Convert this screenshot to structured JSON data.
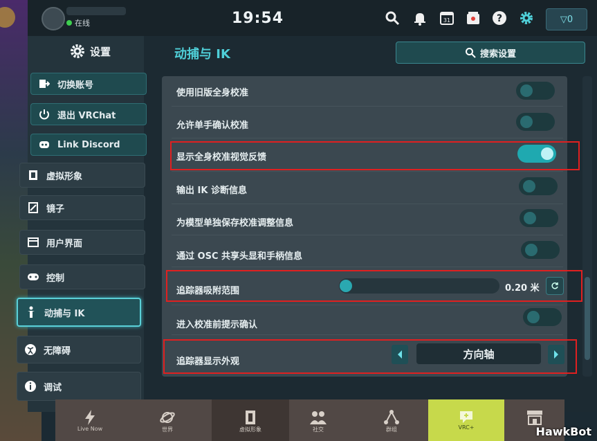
{
  "topbar": {
    "status": "在线",
    "clock": "19:54",
    "vrc_balance": "0",
    "icons": [
      "search-icon",
      "bell-icon",
      "calendar-icon",
      "store-icon",
      "help-icon",
      "gear-icon"
    ],
    "calendar_day": "31"
  },
  "sidebar": {
    "title": "设置",
    "items": [
      {
        "label": "切换账号",
        "icon": "switch-account-icon",
        "style": "teal"
      },
      {
        "label": "退出 VRChat",
        "icon": "power-icon",
        "style": "teal"
      },
      {
        "label": "Link Discord",
        "icon": "discord-icon",
        "style": "teal"
      },
      {
        "label": "虚拟形象",
        "icon": "avatar-icon",
        "style": "dark"
      },
      {
        "label": "镜子",
        "icon": "mirror-icon",
        "style": "dark"
      },
      {
        "label": "用户界面",
        "icon": "ui-icon",
        "style": "dark"
      },
      {
        "label": "控制",
        "icon": "gamepad-icon",
        "style": "dark"
      },
      {
        "label": "动捕与 IK",
        "icon": "person-icon",
        "style": "active"
      },
      {
        "label": "无障碍",
        "icon": "accessibility-icon",
        "style": "dark"
      },
      {
        "label": "调试",
        "icon": "info-icon",
        "style": "dark"
      }
    ]
  },
  "main": {
    "title": "动捕与 IK",
    "search_label": "搜索设置",
    "settings": [
      {
        "label": "使用旧版全身校准",
        "type": "toggle",
        "on": false
      },
      {
        "label": "允许单手确认校准",
        "type": "toggle",
        "on": false
      },
      {
        "label": "显示全身校准视觉反馈",
        "type": "toggle",
        "on": true
      },
      {
        "label": "输出 IK 诊断信息",
        "type": "toggle",
        "on": false
      },
      {
        "label": "为模型单独保存校准调整信息",
        "type": "toggle",
        "on": false
      },
      {
        "label": "通过 OSC 共享头显和手柄信息",
        "type": "toggle",
        "on": false
      },
      {
        "label": "追踪器吸附范围",
        "type": "slider",
        "value": "0.20 米",
        "fraction": 0.0
      },
      {
        "label": "进入校准前提示确认",
        "type": "toggle",
        "on": false
      },
      {
        "label": "追踪器显示外观",
        "type": "select",
        "value": "方向轴"
      }
    ]
  },
  "dock": {
    "items": [
      "Live Now",
      "世界",
      "虚拟形象",
      "社交",
      "群组",
      "VRC+",
      ""
    ]
  },
  "watermark": "HawkBot",
  "colors": {
    "accent": "#4fcfd8",
    "highlight": "#e02020",
    "toggle_on": "#1fa9b0"
  }
}
